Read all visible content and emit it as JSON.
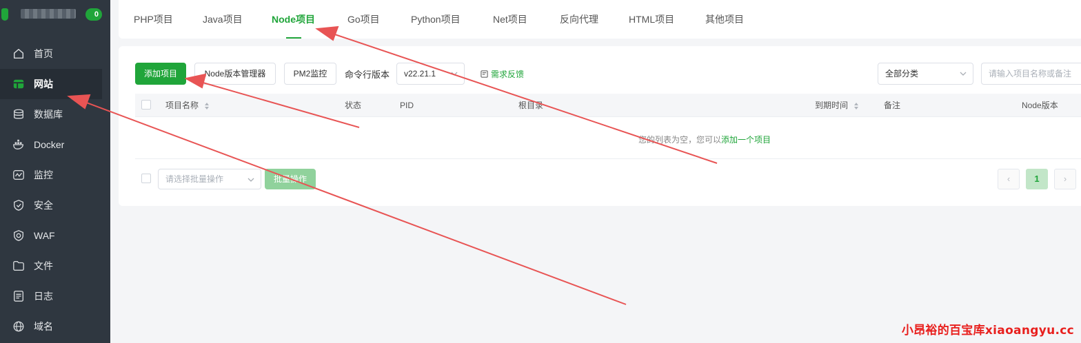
{
  "sidebar": {
    "badge": "0",
    "items": [
      {
        "label": "首页",
        "icon": "home-icon"
      },
      {
        "label": "网站",
        "icon": "website-icon"
      },
      {
        "label": "数据库",
        "icon": "database-icon"
      },
      {
        "label": "Docker",
        "icon": "docker-icon"
      },
      {
        "label": "监控",
        "icon": "monitor-icon"
      },
      {
        "label": "安全",
        "icon": "shield-icon"
      },
      {
        "label": "WAF",
        "icon": "waf-icon"
      },
      {
        "label": "文件",
        "icon": "folder-icon"
      },
      {
        "label": "日志",
        "icon": "log-icon"
      },
      {
        "label": "域名",
        "icon": "domain-icon"
      }
    ],
    "active": "网站"
  },
  "tabs": [
    "PHP项目",
    "Java项目",
    "Node项目",
    "Go项目",
    "Python项目",
    "Net项目",
    "反向代理",
    "HTML项目",
    "其他项目"
  ],
  "active_tab": "Node项目",
  "toolbar": {
    "add_project": "添加项目",
    "node_version_manager": "Node版本管理器",
    "pm2_monitor": "PM2监控",
    "cli_version_label": "命令行版本",
    "cli_version_value": "v22.21.1",
    "feedback": "需求反馈",
    "category_value": "全部分类",
    "search_placeholder": "请输入项目名称或备注"
  },
  "table": {
    "columns": [
      "项目名称",
      "状态",
      "PID",
      "根目录",
      "到期时间",
      "备注",
      "Node版本"
    ],
    "empty_text": "您的列表为空，您可以",
    "empty_link": "添加一个项目"
  },
  "footer": {
    "batch_placeholder": "请选择批量操作",
    "batch_button": "批量操作",
    "prev": "‹",
    "page": "1",
    "next": "›"
  },
  "watermark": "小昂裕的百宝库xiaoangyu.cc",
  "colors": {
    "accent": "#20a53a",
    "sidebar": "#2f3740",
    "annotation_arrow": "#e85454",
    "watermark": "#e8201e"
  }
}
